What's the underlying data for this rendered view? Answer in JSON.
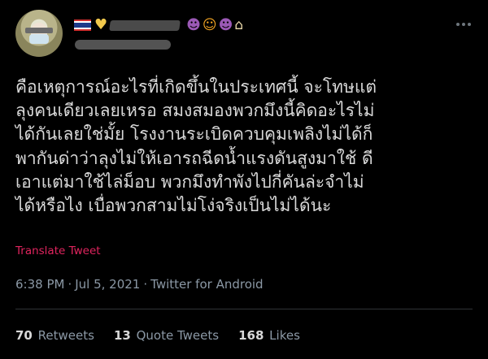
{
  "author": {
    "avatar_icon": "profile-photo",
    "name_emoji_prefix": [
      "thai-flag-icon",
      "yellow-heart-icon"
    ],
    "name_emoji_suffix": [
      "smiling-devil-icon",
      "person-bowing-icon",
      "smiling-devil-icon",
      "cupcake-icon"
    ]
  },
  "tweet": {
    "text": "คือเหตุการณ์อะไรที่เกิดขึ้นในประเทศนี้ จะโทษแต่\nลุงคนเดียวเลยเหรอ สมงสมองพวกมึงนี้คิดอะไรไม่\nได้กันเลยใช่มั้ย โรงงานระเบิดควบคุมเพลิงไม่ได้ก็\nพากันด่าว่าลุงไม่ให้เอารถฉีดน้ำแรงดันสูงมาใช้ ดี\nเอาแต่มาใช้ไล่ม็อบ พวกมึงทำพังไปกี่คันล่ะจำไม่\nได้หรือไง เบื่อพวกสามไม่โง่จริงเป็นไม่ได้นะ",
    "translate_label": "Translate Tweet",
    "time": "6:38 PM",
    "date": "Jul 5, 2021",
    "source": "Twitter for Android",
    "separator": "·"
  },
  "stats": {
    "retweets_count": "70",
    "retweets_label": "Retweets",
    "quotes_count": "13",
    "quotes_label": "Quote Tweets",
    "likes_count": "168",
    "likes_label": "Likes"
  },
  "colors": {
    "background": "#000000",
    "text": "#d9d9d9",
    "muted": "#8b98a5",
    "link": "#e0245e",
    "divider": "#2f3336"
  }
}
